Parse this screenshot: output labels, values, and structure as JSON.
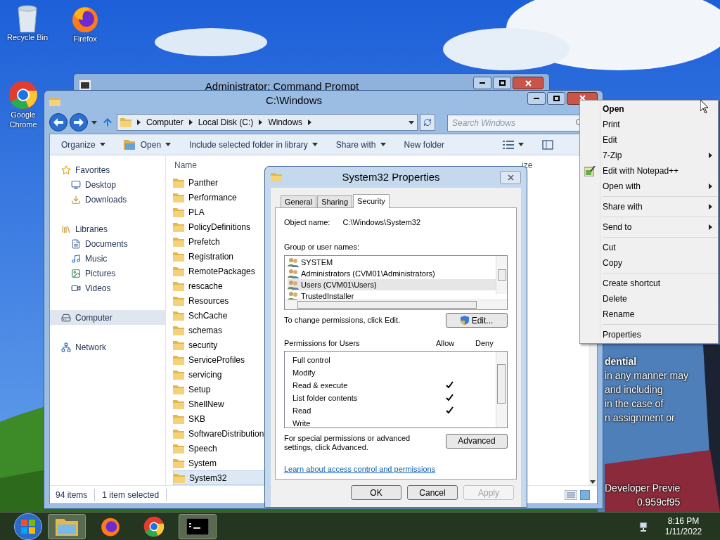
{
  "desktop_icons": [
    {
      "label": "Recycle Bin",
      "kind": "bin"
    },
    {
      "label": "Firefox",
      "kind": "firefox"
    },
    {
      "label": "Google Chrome",
      "kind": "chrome"
    }
  ],
  "cmd_window": {
    "title": "Administrator: Command Prompt"
  },
  "explorer": {
    "title": "C:\\Windows",
    "breadcrumb": [
      "Computer",
      "Local Disk (C:)",
      "Windows"
    ],
    "search": {
      "placeholder": "Search Windows"
    },
    "toolbar": [
      {
        "label": "Organize",
        "kind": "plain",
        "dropdown": true
      },
      {
        "label": "Open",
        "kind": "open",
        "dropdown": true
      },
      {
        "label": "Include selected folder in library",
        "kind": "plain",
        "dropdown": true
      },
      {
        "label": "Share with",
        "kind": "plain",
        "dropdown": true
      },
      {
        "label": "New folder",
        "kind": "plain",
        "dropdown": false
      }
    ],
    "nav": [
      [
        {
          "label": "Favorites",
          "kind": "star",
          "selected": false
        },
        {
          "label": "Desktop",
          "kind": "desktop",
          "selected": false
        },
        {
          "label": "Downloads",
          "kind": "downloads",
          "selected": false
        }
      ],
      [
        {
          "label": "Libraries",
          "kind": "library",
          "selected": false
        },
        {
          "label": "Documents",
          "kind": "documents",
          "selected": false
        },
        {
          "label": "Music",
          "kind": "music",
          "selected": false
        },
        {
          "label": "Pictures",
          "kind": "pictures",
          "selected": false
        },
        {
          "label": "Videos",
          "kind": "videos",
          "selected": false
        }
      ],
      [
        {
          "label": "Computer",
          "kind": "computer",
          "selected": true
        }
      ],
      [
        {
          "label": "Network",
          "kind": "network",
          "selected": false
        }
      ]
    ],
    "columns": [
      "Name",
      "ize"
    ],
    "files": [
      {
        "name": "Panther",
        "selected": false
      },
      {
        "name": "Performance",
        "selected": false
      },
      {
        "name": "PLA",
        "selected": false
      },
      {
        "name": "PolicyDefinitions",
        "selected": false
      },
      {
        "name": "Prefetch",
        "selected": false
      },
      {
        "name": "Registration",
        "selected": false
      },
      {
        "name": "RemotePackages",
        "selected": false
      },
      {
        "name": "rescache",
        "selected": false
      },
      {
        "name": "Resources",
        "selected": false
      },
      {
        "name": "SchCache",
        "selected": false
      },
      {
        "name": "schemas",
        "selected": false
      },
      {
        "name": "security",
        "selected": false
      },
      {
        "name": "ServiceProfiles",
        "selected": false
      },
      {
        "name": "servicing",
        "selected": false
      },
      {
        "name": "Setup",
        "selected": false
      },
      {
        "name": "ShellNew",
        "selected": false
      },
      {
        "name": "SKB",
        "selected": false
      },
      {
        "name": "SoftwareDistribution",
        "selected": false
      },
      {
        "name": "Speech",
        "selected": false
      },
      {
        "name": "System",
        "selected": false
      },
      {
        "name": "System32",
        "selected": true
      }
    ],
    "status": [
      "94 items",
      "1 item selected"
    ]
  },
  "dialog": {
    "title": "System32 Properties",
    "tabs": [
      {
        "label": "General",
        "selected": false
      },
      {
        "label": "Sharing",
        "selected": false
      },
      {
        "label": "Security",
        "selected": true
      }
    ],
    "object_label": "Object name:",
    "object_name": "C:\\Windows\\System32",
    "group_label": "Group or user names:",
    "users": [
      {
        "name": "SYSTEM",
        "selected": false
      },
      {
        "name": "Administrators (CVM01\\Administrators)",
        "selected": false
      },
      {
        "name": "Users (CVM01\\Users)",
        "selected": true
      },
      {
        "name": "TrustedInstaller",
        "selected": false
      }
    ],
    "change_hint": "To change permissions, click Edit.",
    "edit_button": "Edit...",
    "perms_label": "Permissions for Users",
    "allow_label": "Allow",
    "deny_label": "Deny",
    "permissions": [
      {
        "name": "Full control",
        "allow": false,
        "deny": false
      },
      {
        "name": "Modify",
        "allow": false,
        "deny": false
      },
      {
        "name": "Read & execute",
        "allow": true,
        "deny": false
      },
      {
        "name": "List folder contents",
        "allow": true,
        "deny": false
      },
      {
        "name": "Read",
        "allow": true,
        "deny": false
      },
      {
        "name": "Write",
        "allow": false,
        "deny": false
      }
    ],
    "advanced_hint": "For special permissions or advanced settings, click Advanced.",
    "advanced_button": "Advanced",
    "link": "Learn about access control and permissions",
    "buttons": [
      {
        "label": "OK",
        "disabled": false
      },
      {
        "label": "Cancel",
        "disabled": false
      },
      {
        "label": "Apply",
        "disabled": true
      }
    ]
  },
  "context_menu": [
    [
      {
        "label": "Open",
        "default": true,
        "submenu": false,
        "kind": "plain"
      },
      {
        "label": "Print",
        "default": false,
        "submenu": false,
        "kind": "plain"
      },
      {
        "label": "Edit",
        "default": false,
        "submenu": false,
        "kind": "plain"
      },
      {
        "label": "7-Zip",
        "default": false,
        "submenu": true,
        "kind": "plain"
      },
      {
        "label": "Edit with Notepad++",
        "default": false,
        "submenu": false,
        "kind": "notepad"
      },
      {
        "label": "Open with",
        "default": false,
        "submenu": true,
        "kind": "plain"
      }
    ],
    [
      {
        "label": "Share with",
        "default": false,
        "submenu": true,
        "kind": "plain"
      }
    ],
    [
      {
        "label": "Send to",
        "default": false,
        "submenu": true,
        "kind": "plain"
      }
    ],
    [
      {
        "label": "Cut",
        "default": false,
        "submenu": false,
        "kind": "plain"
      },
      {
        "label": "Copy",
        "default": false,
        "submenu": false,
        "kind": "plain"
      }
    ],
    [
      {
        "label": "Create shortcut",
        "default": false,
        "submenu": false,
        "kind": "plain"
      },
      {
        "label": "Delete",
        "default": false,
        "submenu": false,
        "kind": "plain"
      },
      {
        "label": "Rename",
        "default": false,
        "submenu": false,
        "kind": "plain"
      }
    ],
    [
      {
        "label": "Properties",
        "default": false,
        "submenu": false,
        "kind": "plain"
      }
    ]
  ],
  "watermark": [
    "dential",
    "in any manner may",
    "and including",
    "in the case of",
    "n assignment or",
    "Developer Previe",
    "0.959cf95"
  ],
  "taskbar": {
    "apps": [
      {
        "kind": "explorer",
        "active": true
      },
      {
        "kind": "firefox",
        "active": false
      },
      {
        "kind": "chrome",
        "active": false
      },
      {
        "kind": "cmd",
        "active": true
      }
    ],
    "time": "8:16 PM",
    "date": "1/11/2022"
  }
}
